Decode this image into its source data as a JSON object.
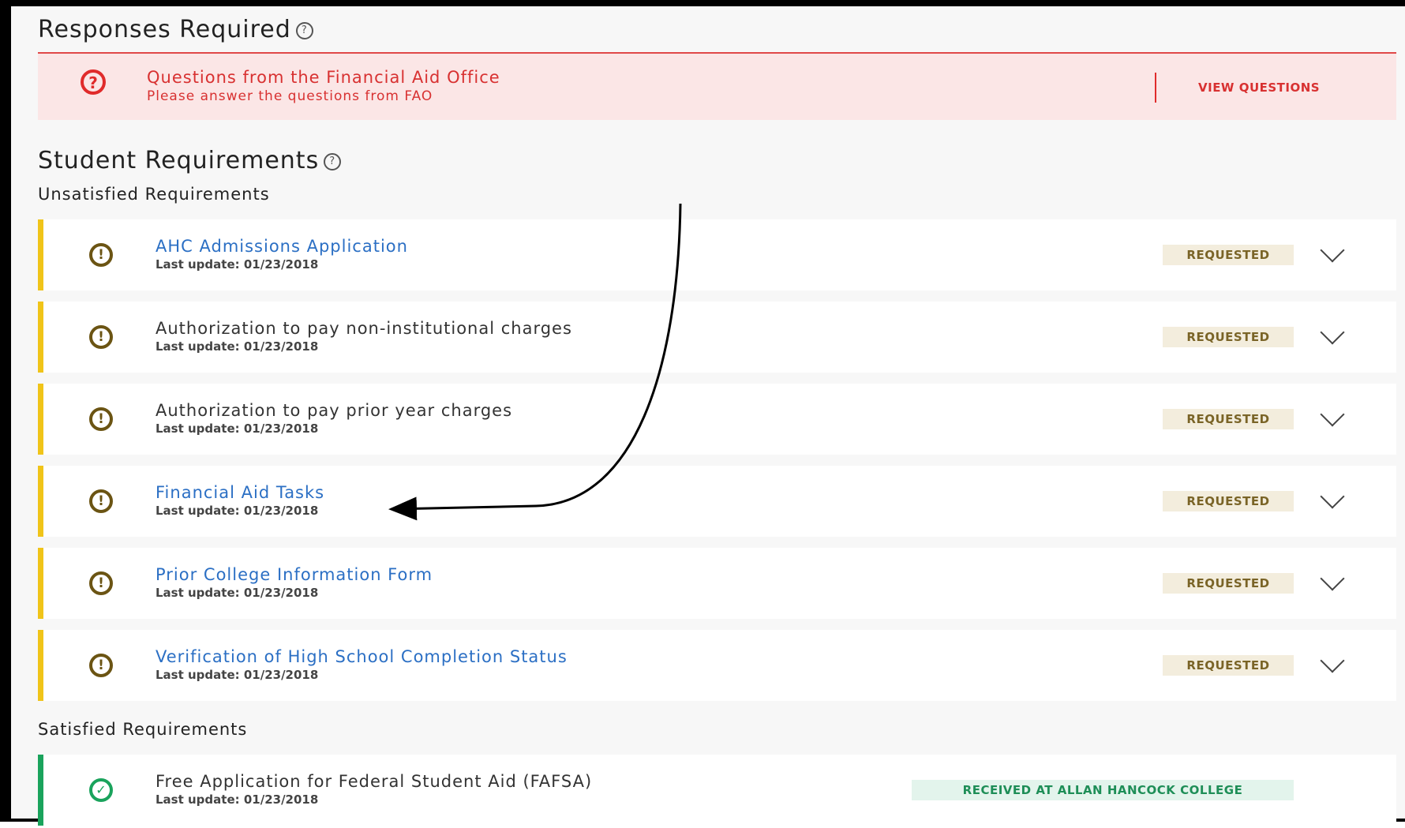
{
  "responses": {
    "title": "Responses Required",
    "help_icon": "?",
    "alert": {
      "icon": "?",
      "title": "Questions from the Financial Aid Office",
      "subtitle": "Please answer the questions from FAO",
      "action_label": "VIEW QUESTIONS"
    }
  },
  "student": {
    "title": "Student Requirements",
    "help_icon": "?",
    "unsatisfied_label": "Unsatisfied Requirements",
    "satisfied_label": "Satisfied Requirements",
    "unsatisfied": [
      {
        "name": "AHC Admissions Application",
        "updated": "Last update: 01/23/2018",
        "status": "REQUESTED",
        "is_link": true
      },
      {
        "name": "Authorization to pay non-institutional charges",
        "updated": "Last update: 01/23/2018",
        "status": "REQUESTED",
        "is_link": false
      },
      {
        "name": "Authorization to pay prior year charges",
        "updated": "Last update: 01/23/2018",
        "status": "REQUESTED",
        "is_link": false
      },
      {
        "name": "Financial Aid Tasks",
        "updated": "Last update: 01/23/2018",
        "status": "REQUESTED",
        "is_link": true
      },
      {
        "name": "Prior College Information Form",
        "updated": "Last update: 01/23/2018",
        "status": "REQUESTED",
        "is_link": true
      },
      {
        "name": "Verification of High School Completion Status",
        "updated": "Last update: 01/23/2018",
        "status": "REQUESTED",
        "is_link": true
      }
    ],
    "satisfied": [
      {
        "name": "Free Application for Federal Student Aid (FAFSA)",
        "updated": "Last update: 01/23/2018",
        "status": "RECEIVED AT ALLAN HANCOCK COLLEGE"
      }
    ]
  },
  "icons": {
    "unsatisfied": "exclamation-circle-icon",
    "satisfied": "check-circle-icon",
    "expand": "chevron-down-icon"
  },
  "colors": {
    "alert": "#e02b2b",
    "pending_accent": "#f0c419",
    "satisfied_accent": "#1aa35c",
    "link": "#2b6fc4"
  }
}
